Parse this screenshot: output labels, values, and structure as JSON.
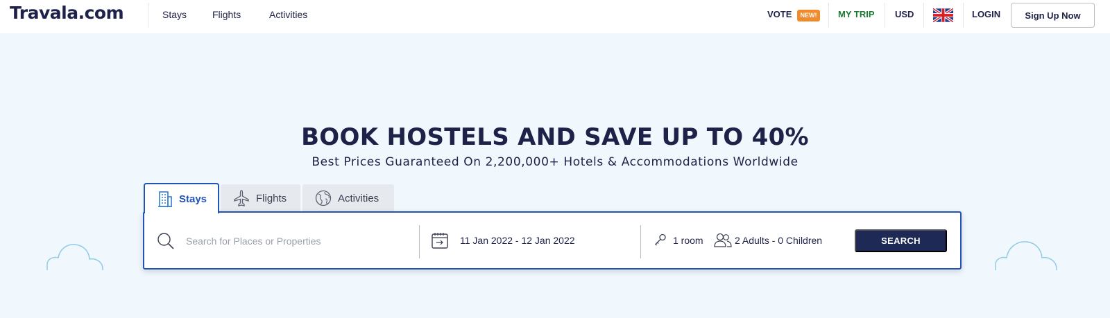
{
  "brand": {
    "logo": "Travala.com"
  },
  "nav": {
    "links": [
      "Stays",
      "Flights",
      "Activities"
    ],
    "vote": "VOTE",
    "new_badge": "NEW!",
    "my_trip": "MY TRIP",
    "currency": "USD",
    "language_flag": "uk-flag-icon",
    "login": "LOGIN",
    "signup": "Sign Up Now"
  },
  "hero": {
    "title": "BOOK HOSTELS AND SAVE UP TO 40%",
    "subtitle": "Best Prices Guaranteed On 2,200,000+ Hotels & Accommodations Worldwide"
  },
  "tabs": [
    {
      "label": "Stays",
      "icon": "building-icon",
      "active": true
    },
    {
      "label": "Flights",
      "icon": "plane-icon",
      "active": false
    },
    {
      "label": "Activities",
      "icon": "globe-icon",
      "active": false
    }
  ],
  "search": {
    "placeholder": "Search for Places or Properties",
    "dates": "11 Jan 2022 - 12 Jan 2022",
    "rooms": "1 room",
    "guests": "2 Adults - 0 Children",
    "button": "SEARCH"
  },
  "colors": {
    "brand_navy": "#1e2148",
    "accent_blue": "#2353b3",
    "my_trip_green": "#1a7a32",
    "badge_orange": "#f08a2a",
    "page_bg": "#f0f7fd"
  }
}
